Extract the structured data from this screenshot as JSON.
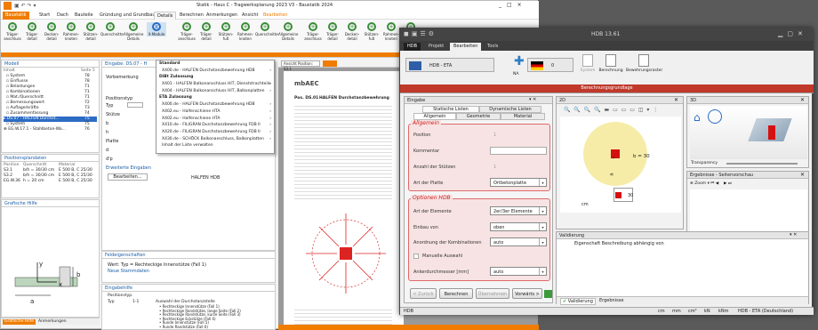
{
  "app1": {
    "title": "Statik - Haus C - Tragwerksplanung 2023 V3 - Baustatik 2024",
    "window_controls": [
      "_",
      "□",
      "×"
    ],
    "tabs": [
      "Baustatik",
      "Start",
      "Dach",
      "Bauteile",
      "Gründung und Grundbau",
      "Details",
      "Berechnen",
      "Anmerkungen",
      "Ansicht",
      "Bearbeiten"
    ],
    "ribbon": [
      "Träger-\nanschluss",
      "Träger-\ndetail",
      "Decken-\ndetail",
      "Rahmen-\nknoten",
      "Stützen-\ndetail",
      "Querschnitte",
      "Allgemeine\nDetails",
      "X-Module",
      "Träger-\nanschluss",
      "Träger-\ndetail",
      "Stützen-\nfuß",
      "Rahmen-\nknoten",
      "Querschnitte",
      "Allgemeine\nDetails",
      "Träger-\nanschluss",
      "Träger-\ndetail",
      "Decken-\ndetail",
      "Stützen-\nfuß",
      "Rahmen-\nknoten",
      "Quer"
    ],
    "model_panel": {
      "title": "Modell",
      "col_inhalt": "Inhalt",
      "col_seite": "Seite 5",
      "rows": [
        [
          "System",
          "78"
        ],
        [
          "Einflusse",
          "78"
        ],
        [
          "Belastungen",
          "71"
        ],
        [
          "Kombinationen",
          "71"
        ],
        [
          "Mat./Querschnitt",
          "71"
        ],
        [
          "Bemessungswert",
          "72"
        ],
        [
          "Auflagerkräfte",
          "73"
        ],
        [
          "Zusammenfassung",
          "74"
        ],
        [
          "DS.07 - HALFEN Durchst...",
          "75"
        ],
        [
          "System",
          "75"
        ],
        [
          "EG.W.17.1 - Stahlbeton-Wa...",
          "76"
        ]
      ]
    },
    "positions_panel": {
      "title": "Positionsplandaten",
      "cols": [
        "Position",
        "Querschnitt",
        "Material"
      ],
      "rows": [
        [
          "S3.1",
          "b/h = 30/30 cm",
          "E 500 B, C 25/30"
        ],
        [
          "S3.2",
          "b/h = 30/30 cm",
          "E 500 B, C 25/30"
        ],
        [
          "EG.W.36",
          "h = 20 cm",
          "E 500 B, C 25/30"
        ]
      ]
    },
    "grafik_panel": {
      "title": "Grafische Hilfe",
      "y": "y",
      "x": "x",
      "b": "b",
      "a": "a"
    },
    "bottom_tabs": [
      "Grafische Hilfe",
      "Anmerkungen"
    ],
    "eingabe": {
      "title": "Eingabe: DS.07 - H",
      "vorbemerkung": "Vorbemerkung",
      "positionstyp": "Positionstyp",
      "typ": "Typ",
      "stuetze": "Stütze",
      "b": "b",
      "h": "h",
      "platte": "Platte",
      "d": "d",
      "dp": "d'p",
      "erweiterte": "Erweiterte Eingaben",
      "bearbeiten": "Bearbeiten...",
      "halfen": "HALFEN HDB"
    },
    "menu": [
      {
        "t": "Standard",
        "h": true
      },
      {
        "t": "X400.de - HALFEN Durchstanzbewehrung HDB",
        "a": true
      },
      {
        "t": "DiBt Zulassung",
        "h": true
      },
      {
        "t": "X401 - HALFEN Balkonanschluss HIT, Dienststrachteile",
        "a": true
      },
      {
        "t": "X404 - HALFEN Balkonanschluss HIT, Balkonplatten",
        "a": true
      },
      {
        "t": "ETA Zulassung",
        "h": true
      },
      {
        "t": "X400.de - HALFEN Durchstanzbewehrung HDB",
        "a": true
      },
      {
        "t": "X402.eu - Halfenschiene HTA",
        "a": true
      },
      {
        "t": "X402.eu - Halfenschiene HTA",
        "a": true
      },
      {
        "t": "X410.de - FILIGRAN Durchstanzbewehrung FDB II",
        "a": true
      },
      {
        "t": "X420.de - FILIGRAN Durchstanzbewehrung FDB II",
        "a": true
      },
      {
        "t": "X430.de - SCHÖCK Balkonanschluss, Balkonplatten",
        "a": true
      },
      {
        "t": "Inhalt der Liste verwalten",
        "a": false
      }
    ],
    "feldeigenschaften": {
      "title": "Feldeigenschaften",
      "wert": "Wert: Typ = Rechteckige Innenstütze (Fall 1)",
      "neue": "Neue Stammdaten"
    },
    "eingabehilfe": {
      "title": "Eingabehilfe",
      "pos": "Positionstyp.",
      "typ": "Typ",
      "typval": "1-1",
      "auswahl": "Auswahl der Durchstanzstelle",
      "items": [
        "• Rechteckige Innenstütze (Fall 1)",
        "• Rechteckige Randstütze, lange Seite (Fall 2)",
        "• Rechteckige Randstütze, kurze Seite (Fall 3)",
        "• Rechteckige Eckstütze (Fall 4)",
        "• Runde Innenstütze (Fall 5)",
        "• Runde Randstütze (Fall 6)",
        "• Runde Eckstütze (Fall 7)",
        "• Innenecke (Fall 8)",
        "• Wandende (Fall 9)"
      ],
      "stuetze": "Stütze"
    },
    "eh_tabs": [
      "Eingabehilfe",
      "Modellhinweise"
    ],
    "preview": {
      "tab": "Ansicht Position: S3.1",
      "logo": "mbAEC",
      "heading": "Pos. DS.01",
      "sub": "HALFEN Durchstanzbewehrung"
    }
  },
  "app2": {
    "title": "HDB 13.61",
    "title_icons": [
      "◼",
      "▣",
      "☰",
      "⚙"
    ],
    "tabs": [
      "HDB",
      "Projekt",
      "Bearbeiten",
      "Tools"
    ],
    "ribbon": {
      "hdb_eta": "HDB - ETA",
      "na": "NA",
      "ziffer": "0",
      "system": "System",
      "berechnung": "Berechnung",
      "bewehrungsraster": "Bewehrungsraster",
      "group": "Berechnungsgrundlage"
    },
    "eingabe": {
      "title": "Eingabe",
      "tabs_top": [
        "Statische Listen",
        "Dynamische Listen"
      ],
      "tabs_bottom": [
        "Allgemein",
        "Geometrie",
        "Material"
      ],
      "allgemein": "Allgemein",
      "position": "Position",
      "position_val": "1",
      "kommentar": "Kommentar",
      "anzahl": "Anzahl der Stützen",
      "anzahl_val": "1",
      "art_platte": "Art der Platte",
      "art_platte_val": "Ortbetonplatte",
      "optionen": "Optionen HDB",
      "art_elemente": "Art der Elemente",
      "art_elemente_val": "2er/3er Elemente",
      "einbau": "Einbau von",
      "einbau_val": "oben",
      "anordnung": "Anordnung der Kombinationen",
      "anordnung_val": "auto",
      "manuelle": "Manuelle Auswahl",
      "anker": "Ankerdurchmesser   [mm]",
      "anker_val": "auto",
      "buttons": [
        "< Zurück",
        "Berechnen",
        "Übernehmen",
        "Vorwärts >"
      ]
    },
    "view2d": {
      "title": "2D",
      "dim": "b = 30",
      "dim2": "a",
      "dim3": "30",
      "unit": "cm"
    },
    "view3d": {
      "title": "3D",
      "transparency": "Transparency"
    },
    "ergebnisse": {
      "title": "Ergebnisse - Seitenvorschau",
      "zoom": "Zoom"
    },
    "validierung": {
      "title": "Validierung",
      "col": "Eigenschaft Beschreibung abhängig von",
      "tabs": [
        "Validierung",
        "Ergebnisse"
      ]
    },
    "status": {
      "left": "HDB",
      "units": [
        "cm",
        "mm",
        "cm²",
        "kN",
        "kNm",
        "HDB - ETA (Deutschland)"
      ]
    }
  },
  "colors": {
    "accent": "#f07c00",
    "dark": "#444444",
    "red": "#d02020"
  }
}
